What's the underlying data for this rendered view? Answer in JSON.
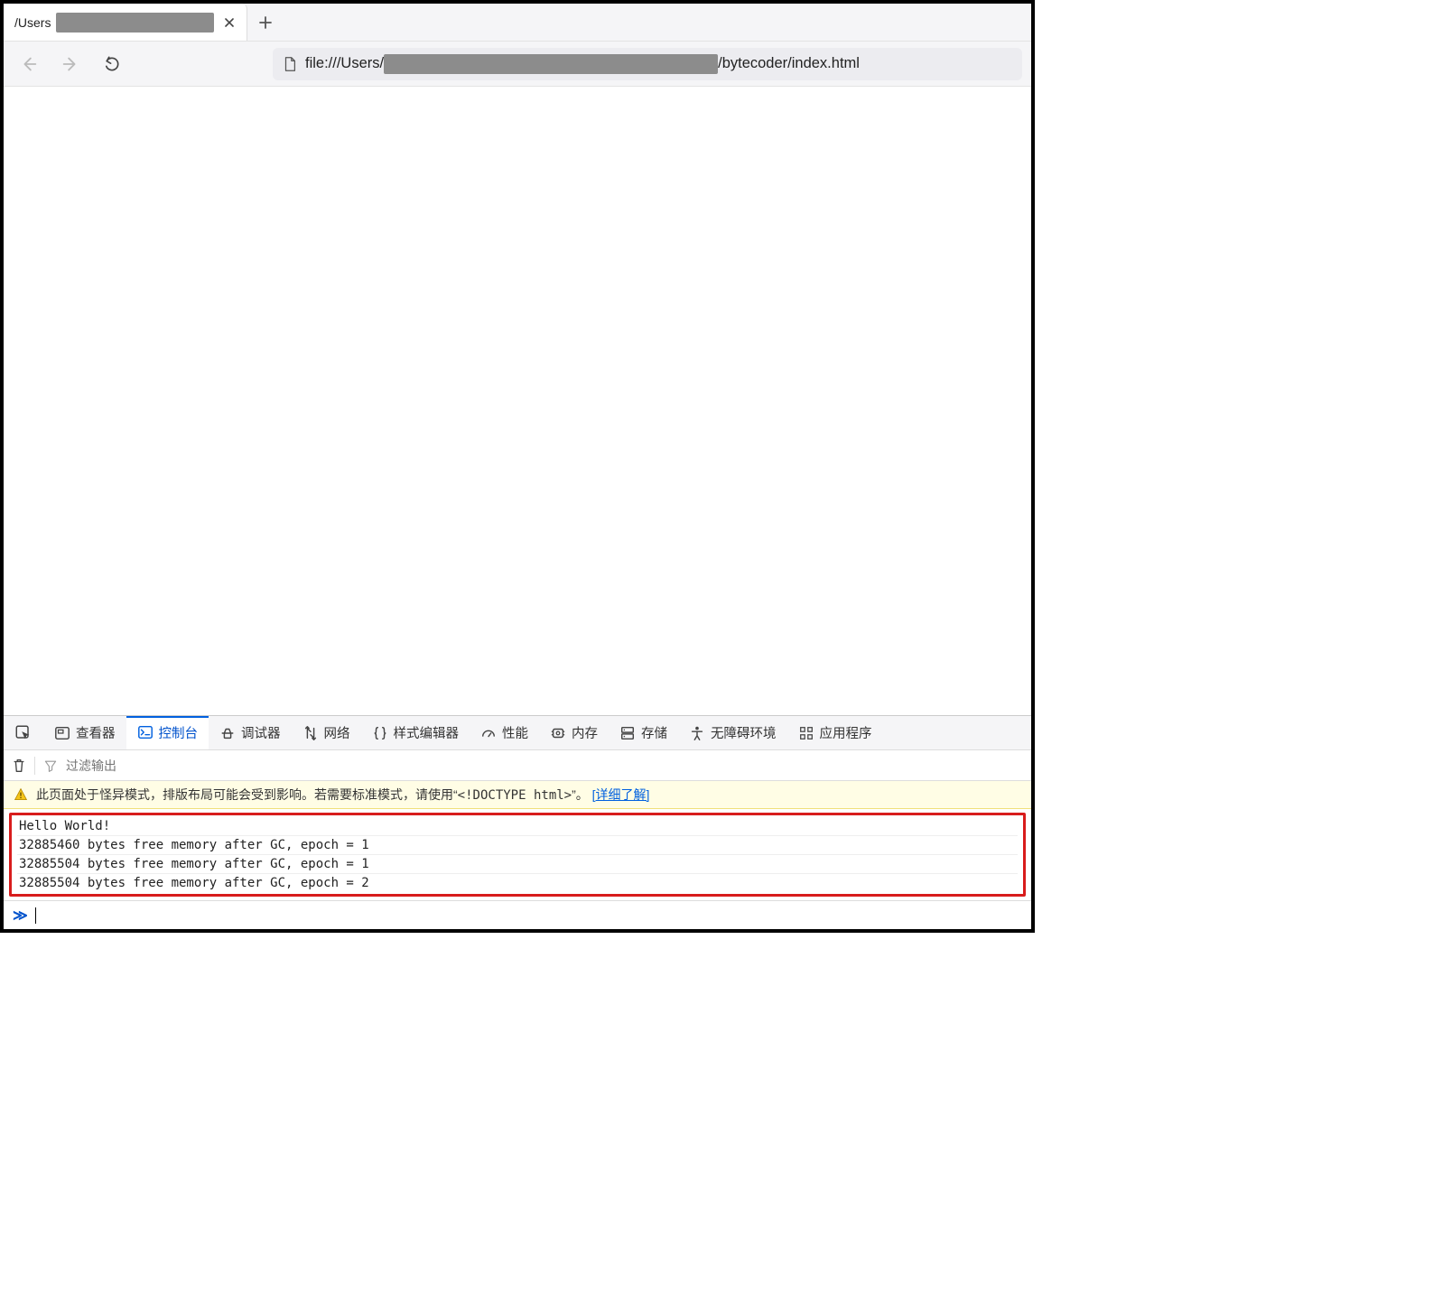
{
  "tab": {
    "title_prefix": "/Users",
    "close_name": "close-icon"
  },
  "nav": {
    "url_prefix": "file:///Users/",
    "url_suffix": "/bytecoder/index.html"
  },
  "devtools": {
    "tabs": {
      "inspector": "查看器",
      "console": "控制台",
      "debugger": "调试器",
      "network": "网络",
      "style": "样式编辑器",
      "perf": "性能",
      "memory": "内存",
      "storage": "存储",
      "a11y": "无障碍环境",
      "apps": "应用程序"
    },
    "filter_placeholder": "过滤输出",
    "warning": {
      "text_a": "此页面处于怪异模式，排版布局可能会受到影响。若需要标准模式，请使用“",
      "doctype": "<!DOCTYPE html>",
      "text_b": "”。 ",
      "link": "[详细了解]"
    },
    "logs": [
      "Hello World!",
      "32885460 bytes free memory after GC, epoch = 1",
      "32885504 bytes free memory after GC, epoch = 1",
      "32885504 bytes free memory after GC, epoch = 2"
    ],
    "prompt": "≫"
  }
}
